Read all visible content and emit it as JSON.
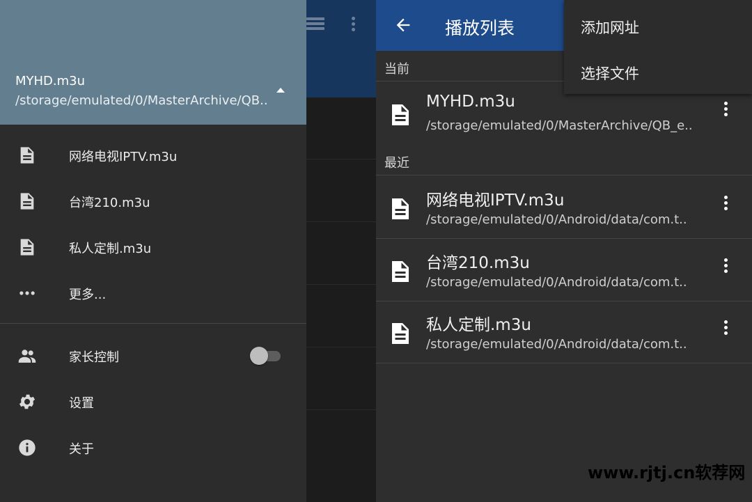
{
  "drawer": {
    "header": {
      "title": "MYHD.m3u",
      "path": "/storage/emulated/0/MasterArchive/QB.."
    },
    "items": [
      {
        "label": "网络电视IPTV.m3u",
        "icon": "file-icon"
      },
      {
        "label": "台湾210.m3u",
        "icon": "file-icon"
      },
      {
        "label": "私人定制.m3u",
        "icon": "file-icon"
      },
      {
        "label": "更多...",
        "icon": "more-horizontal-icon"
      }
    ],
    "settings": [
      {
        "label": "家长控制",
        "icon": "people-icon",
        "toggle": false
      },
      {
        "label": "设置",
        "icon": "gear-icon"
      },
      {
        "label": "关于",
        "icon": "info-icon"
      }
    ]
  },
  "playlist": {
    "title": "播放列表",
    "section_current": "当前",
    "section_recent": "最近",
    "current": [
      {
        "title": "MYHD.m3u",
        "path": "/storage/emulated/0/MasterArchive/QB_e.."
      }
    ],
    "recent": [
      {
        "title": "网络电视IPTV.m3u",
        "path": "/storage/emulated/0/Android/data/com.t.."
      },
      {
        "title": "台湾210.m3u",
        "path": "/storage/emulated/0/Android/data/com.t.."
      },
      {
        "title": "私人定制.m3u",
        "path": "/storage/emulated/0/Android/data/com.t.."
      }
    ],
    "menu": [
      "添加网址",
      "选择文件"
    ]
  },
  "watermark": "www.rjtj.cn软荐网",
  "colors": {
    "drawer_header": "#637f8f",
    "drawer_bg": "#2c2c2c",
    "toolbar_blue": "#1e4b8b",
    "panel_bg": "#2e2e2e"
  }
}
